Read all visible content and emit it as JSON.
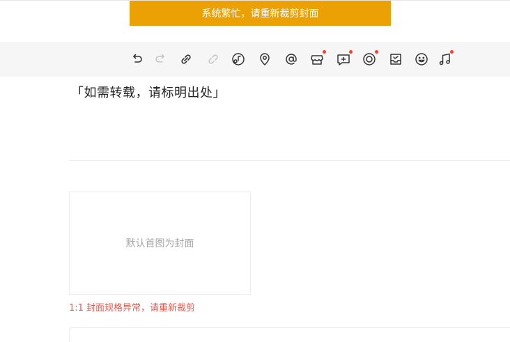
{
  "toast": {
    "message": "系统繁忙，请重新裁剪封面",
    "color": "#eba103"
  },
  "toolbar": {
    "tools": [
      {
        "icon": "undo-icon",
        "badge": false
      },
      {
        "icon": "redo-icon",
        "badge": false,
        "disabled": true
      },
      {
        "icon": "link-icon",
        "badge": false
      },
      {
        "icon": "unlink-icon",
        "badge": false,
        "disabled": true
      },
      {
        "icon": "music-disc-icon",
        "badge": false
      },
      {
        "icon": "location-pin-icon",
        "badge": false
      },
      {
        "icon": "at-mention-icon",
        "badge": false
      },
      {
        "icon": "shop-icon",
        "badge": true
      },
      {
        "icon": "gift-message-icon",
        "badge": true
      },
      {
        "icon": "circle-target-icon",
        "badge": true
      },
      {
        "icon": "inbox-check-icon",
        "badge": false
      },
      {
        "icon": "emoji-icon",
        "badge": false
      },
      {
        "icon": "music-note-icon",
        "badge": true
      }
    ],
    "badge_color": "#ff3b30"
  },
  "article": {
    "statement": "「如需转载，请标明出处」"
  },
  "cover": {
    "placeholder": "默认首图为封面",
    "error": "1:1 封面规格异常，请重新裁剪",
    "error_color": "#e05a4f"
  }
}
